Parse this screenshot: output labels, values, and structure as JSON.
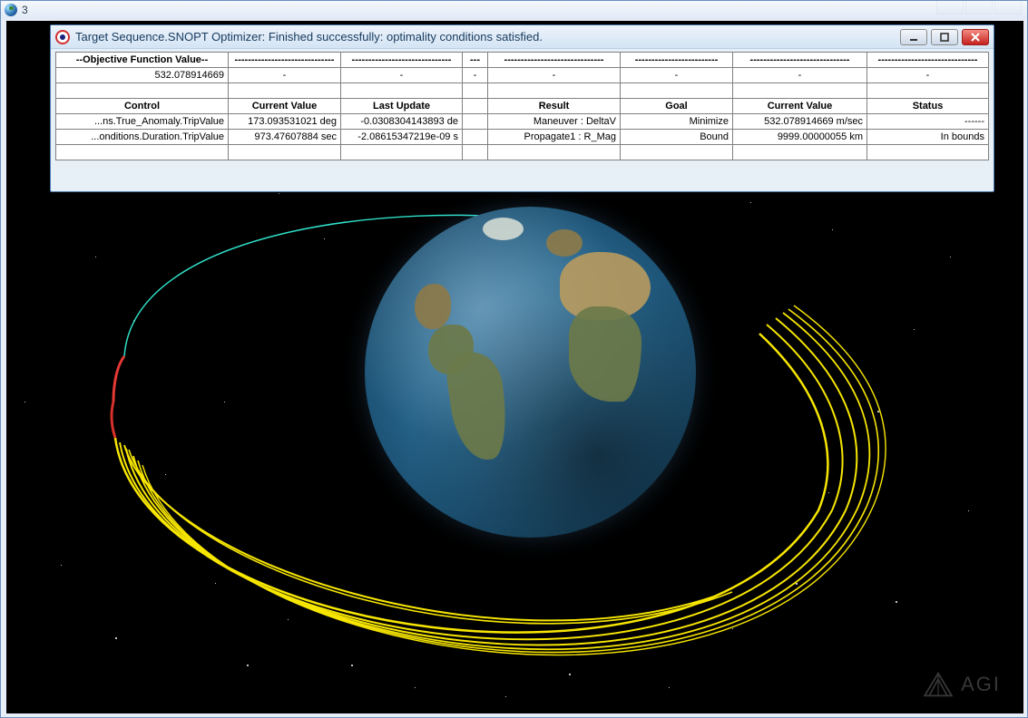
{
  "outer_window": {
    "title_fragment": "3"
  },
  "optimizer_window": {
    "title": "Target Sequence.SNOPT Optimizer: Finished successfully: optimality conditions satisfied."
  },
  "objective": {
    "label": "--Objective Function Value--",
    "value": "532.078914669"
  },
  "headers": {
    "control": "Control",
    "current_value": "Current Value",
    "last_update": "Last Update",
    "result": "Result",
    "goal": "Goal",
    "current_value2": "Current Value",
    "status": "Status"
  },
  "rows": [
    {
      "control": "...ns.True_Anomaly.TripValue",
      "current_value": "173.093531021 deg",
      "last_update": "-0.0308304143893 de",
      "result": "Maneuver : DeltaV",
      "goal": "Minimize",
      "current_value2": "532.078914669 m/sec",
      "status": "------"
    },
    {
      "control": "...onditions.Duration.TripValue",
      "current_value": "973.47607884 sec",
      "last_update": "-2.08615347219e-09 s",
      "result": "Propagate1 : R_Mag",
      "goal": "Bound",
      "current_value2": "9999.00000055 km",
      "status": "In bounds"
    }
  ],
  "dashes": {
    "long": "------------------------------",
    "mid": "-------------------------",
    "short": "---"
  },
  "logo_text": "AGI"
}
